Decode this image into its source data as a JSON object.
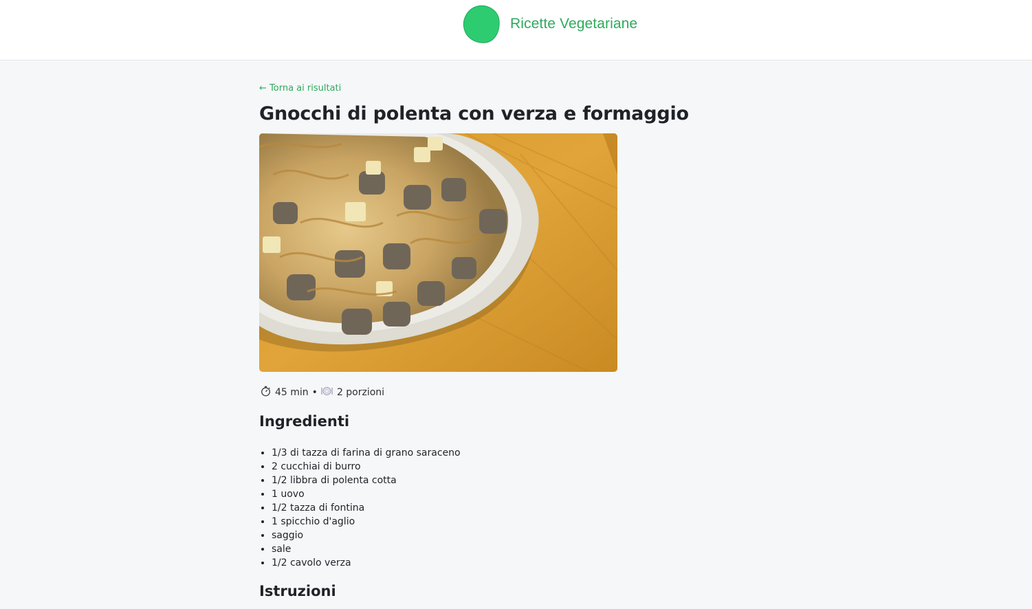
{
  "header": {
    "brand_name": "Ricette Vegetariane",
    "brand_color": "#2eaa5c",
    "logo_icon": "green-blob-logo-icon"
  },
  "nav": {
    "back_label": "← Torna ai risultati"
  },
  "recipe": {
    "title": "Gnocchi di polenta con verza e formaggio",
    "image_alt": "Gnocchi di polenta con verza e formaggio",
    "time": "45 min",
    "time_icon": "stopwatch-icon",
    "separator": "•",
    "servings": "2 porzioni",
    "servings_icon": "plate-icon"
  },
  "sections": {
    "ingredients_title": "Ingredienti",
    "instructions_title": "Istruzioni"
  },
  "ingredients": [
    "1/3 di tazza di farina di grano saraceno",
    "2 cucchiai di burro",
    "1/2 libbra di polenta cotta",
    "1 uovo",
    "1/2 tazza di fontina",
    "1 spicchio d'aglio",
    "saggio",
    "sale",
    "1/2 cavolo verza"
  ]
}
